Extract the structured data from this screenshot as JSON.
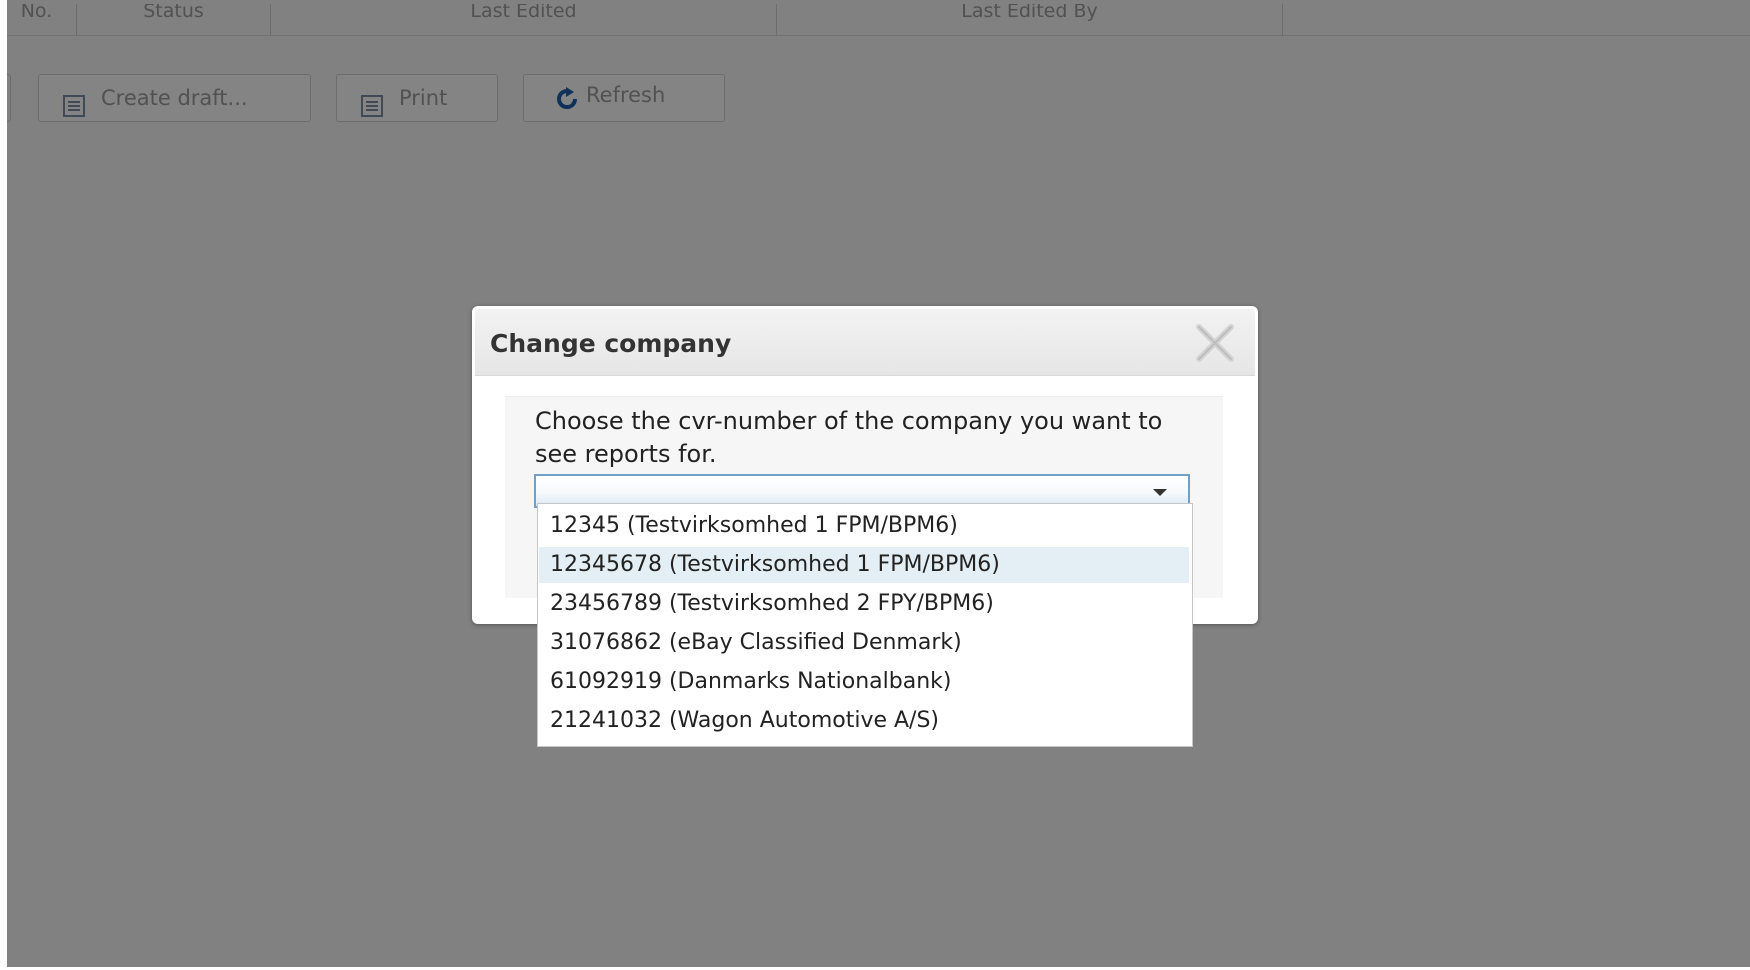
{
  "background": {
    "grid_columns": [
      "No.",
      "Status",
      "Last Edited",
      "Last Edited By"
    ],
    "toolbar": {
      "create_draft_label": "Create draft...",
      "print_label": "Print",
      "refresh_label": "Refresh"
    }
  },
  "dialog": {
    "title": "Change company",
    "prompt": "Choose the cvr-number of the company you want to see reports for.",
    "selected_value": "",
    "options": [
      "12345 (Testvirksomhed 1 FPM/BPM6)",
      "12345678 (Testvirksomhed 1 FPM/BPM6)",
      "23456789 (Testvirksomhed 2 FPY/BPM6)",
      "31076862 (eBay Classified Denmark)",
      "61092919 (Danmarks Nationalbank)",
      "21241032 (Wagon Automotive A/S)"
    ],
    "highlighted_option_index": 1
  },
  "colors": {
    "overlay": "#000000",
    "combo_border": "#6ea0c8",
    "option_highlight": "#e3eff4"
  },
  "icons": {
    "close": "close-icon",
    "dropdown": "chevron-down-icon",
    "document": "document-icon",
    "refresh": "refresh-icon"
  }
}
